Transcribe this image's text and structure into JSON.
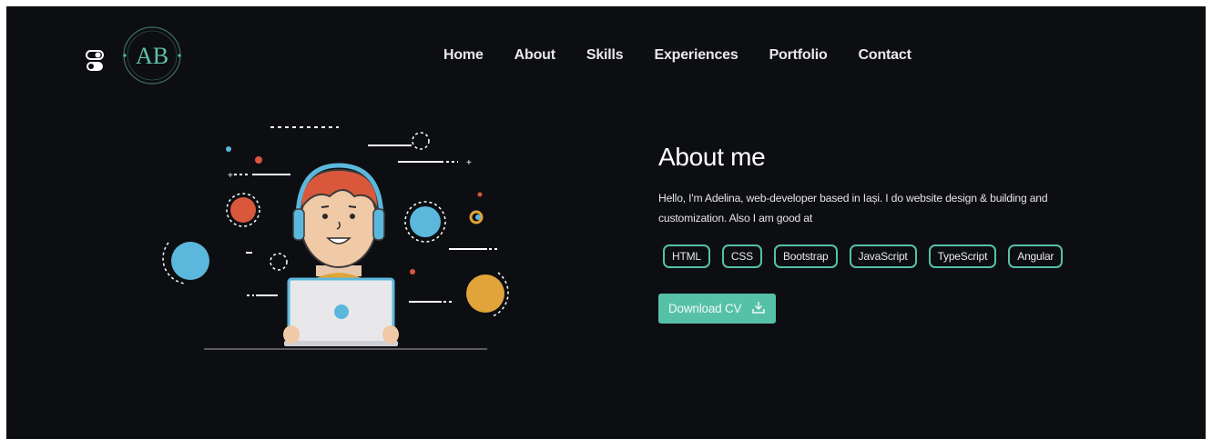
{
  "header": {
    "logo_initials": "AB",
    "nav": [
      {
        "label": "Home"
      },
      {
        "label": "About"
      },
      {
        "label": "Skills"
      },
      {
        "label": "Experiences"
      },
      {
        "label": "Portfolio"
      },
      {
        "label": "Contact"
      }
    ]
  },
  "about": {
    "title": "About me",
    "text": "Hello, I'm Adelina, web-developer based in Iași. I do website design & building and customization. Also I am good at",
    "skills": [
      "HTML",
      "CSS",
      "Bootstrap",
      "JavaScript",
      "TypeScript",
      "Angular"
    ],
    "download_label": "Download CV"
  },
  "icons": {
    "theme_toggle": "toggle-icon",
    "download": "download-icon"
  },
  "colors": {
    "background": "#0d0e12",
    "accent": "#57c1a7",
    "nav_text": "#e9e9ea"
  }
}
